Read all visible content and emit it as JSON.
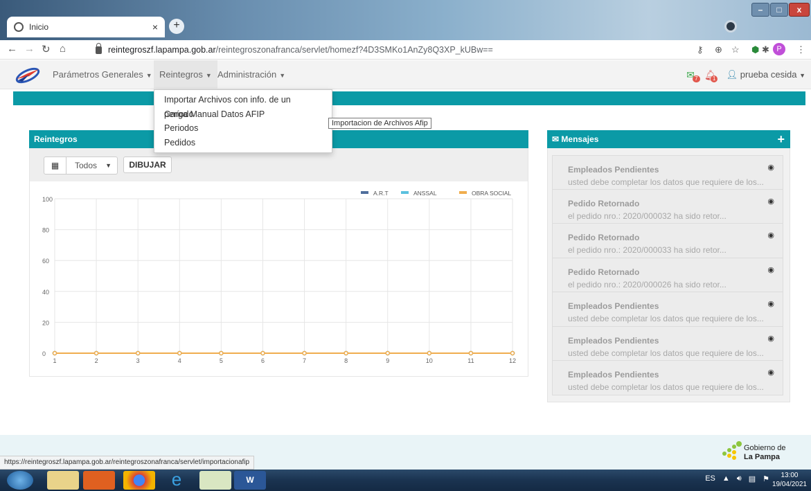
{
  "browser": {
    "tab_title": "Inicio",
    "tab_close": "×",
    "new_tab": "+",
    "url_host": "reintegroszf.lapampa.gob.ar",
    "url_path": "/reintegroszonafranca/servlet/homezf?4D3SMKo1AnZy8Q3XP_kUBw==",
    "profile_initial": "P",
    "status_url": "https://reintegroszf.lapampa.gob.ar/reintegroszonafranca/servlet/importacionafip"
  },
  "nav": {
    "menu1": "Parámetros Generales",
    "menu2": "Reintegros",
    "menu3": "Administración",
    "user": "prueba cesida",
    "mail_count": "7",
    "bell_count": "1"
  },
  "dropdown": {
    "items": [
      "Importar Archivos con info. de un período",
      "Carga Manual Datos AFIP",
      "Periodos",
      "Pedidos"
    ],
    "tooltip": "Importacion de Archivos Afip"
  },
  "reintegros": {
    "title": "Reintegros",
    "select_value": "Todos",
    "draw_label": "DIBUJAR"
  },
  "chart_data": {
    "type": "line",
    "x": [
      1,
      2,
      3,
      4,
      5,
      6,
      7,
      8,
      9,
      10,
      11,
      12
    ],
    "ylim": [
      0,
      100
    ],
    "yticks": [
      0,
      20,
      40,
      60,
      80,
      100
    ],
    "legend_position": "top-right",
    "grid": true,
    "series": [
      {
        "name": "A.R.T",
        "color": "#4f6e9c",
        "values": [
          0,
          0,
          0,
          0,
          0,
          0,
          0,
          0,
          0,
          0,
          0,
          0
        ]
      },
      {
        "name": "ANSSAL",
        "color": "#5bc0de",
        "values": [
          0,
          0,
          0,
          0,
          0,
          0,
          0,
          0,
          0,
          0,
          0,
          0
        ]
      },
      {
        "name": "OBRA SOCIAL",
        "color": "#f0ad4e",
        "values": [
          0,
          0,
          0,
          0,
          0,
          0,
          0,
          0,
          0,
          0,
          0,
          0
        ]
      }
    ]
  },
  "mensajes": {
    "title": "Mensajes",
    "items": [
      {
        "title": "Empleados Pendientes",
        "body": "usted debe completar los datos que requiere de los..."
      },
      {
        "title": "Pedido Retornado",
        "body": "el pedido nro.: 2020/000032 ha sido retor..."
      },
      {
        "title": "Pedido Retornado",
        "body": "el pedido nro.: 2020/000033 ha sido retor..."
      },
      {
        "title": "Pedido Retornado",
        "body": "el pedido nro.: 2020/000026 ha sido retor..."
      },
      {
        "title": "Empleados Pendientes",
        "body": "usted debe completar los datos que requiere de los..."
      },
      {
        "title": "Empleados Pendientes",
        "body": "usted debe completar los datos que requiere de los..."
      },
      {
        "title": "Empleados Pendientes",
        "body": "usted debe completar los datos que requiere de los..."
      }
    ]
  },
  "footer": {
    "gov_line1": "Gobierno de",
    "gov_line2": "La Pampa"
  },
  "taskbar": {
    "lang": "ES",
    "time": "13:00",
    "date": "19/04/2021"
  }
}
